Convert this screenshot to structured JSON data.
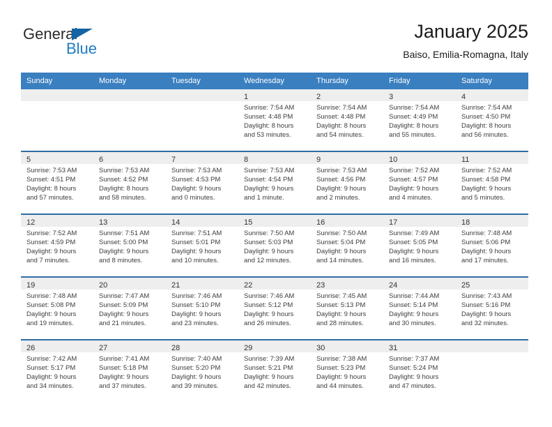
{
  "brand": {
    "name_part1": "General",
    "name_part2": "Blue",
    "triangle_color": "#1464a5",
    "blue_color": "#1d7cc4"
  },
  "header": {
    "title": "January 2025",
    "subtitle": "Baiso, Emilia-Romagna, Italy"
  },
  "theme": {
    "header_row_bg": "#3a7fc0",
    "row_divider": "#2e6da4",
    "day_band_bg": "#eeeeee"
  },
  "weekday_headers": [
    "Sunday",
    "Monday",
    "Tuesday",
    "Wednesday",
    "Thursday",
    "Friday",
    "Saturday"
  ],
  "weeks": [
    [
      {
        "day": "",
        "sunrise": "",
        "sunset": "",
        "daylight_l1": "",
        "daylight_l2": ""
      },
      {
        "day": "",
        "sunrise": "",
        "sunset": "",
        "daylight_l1": "",
        "daylight_l2": ""
      },
      {
        "day": "",
        "sunrise": "",
        "sunset": "",
        "daylight_l1": "",
        "daylight_l2": ""
      },
      {
        "day": "1",
        "sunrise": "Sunrise: 7:54 AM",
        "sunset": "Sunset: 4:48 PM",
        "daylight_l1": "Daylight: 8 hours",
        "daylight_l2": "and 53 minutes."
      },
      {
        "day": "2",
        "sunrise": "Sunrise: 7:54 AM",
        "sunset": "Sunset: 4:48 PM",
        "daylight_l1": "Daylight: 8 hours",
        "daylight_l2": "and 54 minutes."
      },
      {
        "day": "3",
        "sunrise": "Sunrise: 7:54 AM",
        "sunset": "Sunset: 4:49 PM",
        "daylight_l1": "Daylight: 8 hours",
        "daylight_l2": "and 55 minutes."
      },
      {
        "day": "4",
        "sunrise": "Sunrise: 7:54 AM",
        "sunset": "Sunset: 4:50 PM",
        "daylight_l1": "Daylight: 8 hours",
        "daylight_l2": "and 56 minutes."
      }
    ],
    [
      {
        "day": "5",
        "sunrise": "Sunrise: 7:53 AM",
        "sunset": "Sunset: 4:51 PM",
        "daylight_l1": "Daylight: 8 hours",
        "daylight_l2": "and 57 minutes."
      },
      {
        "day": "6",
        "sunrise": "Sunrise: 7:53 AM",
        "sunset": "Sunset: 4:52 PM",
        "daylight_l1": "Daylight: 8 hours",
        "daylight_l2": "and 58 minutes."
      },
      {
        "day": "7",
        "sunrise": "Sunrise: 7:53 AM",
        "sunset": "Sunset: 4:53 PM",
        "daylight_l1": "Daylight: 9 hours",
        "daylight_l2": "and 0 minutes."
      },
      {
        "day": "8",
        "sunrise": "Sunrise: 7:53 AM",
        "sunset": "Sunset: 4:54 PM",
        "daylight_l1": "Daylight: 9 hours",
        "daylight_l2": "and 1 minute."
      },
      {
        "day": "9",
        "sunrise": "Sunrise: 7:53 AM",
        "sunset": "Sunset: 4:56 PM",
        "daylight_l1": "Daylight: 9 hours",
        "daylight_l2": "and 2 minutes."
      },
      {
        "day": "10",
        "sunrise": "Sunrise: 7:52 AM",
        "sunset": "Sunset: 4:57 PM",
        "daylight_l1": "Daylight: 9 hours",
        "daylight_l2": "and 4 minutes."
      },
      {
        "day": "11",
        "sunrise": "Sunrise: 7:52 AM",
        "sunset": "Sunset: 4:58 PM",
        "daylight_l1": "Daylight: 9 hours",
        "daylight_l2": "and 5 minutes."
      }
    ],
    [
      {
        "day": "12",
        "sunrise": "Sunrise: 7:52 AM",
        "sunset": "Sunset: 4:59 PM",
        "daylight_l1": "Daylight: 9 hours",
        "daylight_l2": "and 7 minutes."
      },
      {
        "day": "13",
        "sunrise": "Sunrise: 7:51 AM",
        "sunset": "Sunset: 5:00 PM",
        "daylight_l1": "Daylight: 9 hours",
        "daylight_l2": "and 8 minutes."
      },
      {
        "day": "14",
        "sunrise": "Sunrise: 7:51 AM",
        "sunset": "Sunset: 5:01 PM",
        "daylight_l1": "Daylight: 9 hours",
        "daylight_l2": "and 10 minutes."
      },
      {
        "day": "15",
        "sunrise": "Sunrise: 7:50 AM",
        "sunset": "Sunset: 5:03 PM",
        "daylight_l1": "Daylight: 9 hours",
        "daylight_l2": "and 12 minutes."
      },
      {
        "day": "16",
        "sunrise": "Sunrise: 7:50 AM",
        "sunset": "Sunset: 5:04 PM",
        "daylight_l1": "Daylight: 9 hours",
        "daylight_l2": "and 14 minutes."
      },
      {
        "day": "17",
        "sunrise": "Sunrise: 7:49 AM",
        "sunset": "Sunset: 5:05 PM",
        "daylight_l1": "Daylight: 9 hours",
        "daylight_l2": "and 16 minutes."
      },
      {
        "day": "18",
        "sunrise": "Sunrise: 7:48 AM",
        "sunset": "Sunset: 5:06 PM",
        "daylight_l1": "Daylight: 9 hours",
        "daylight_l2": "and 17 minutes."
      }
    ],
    [
      {
        "day": "19",
        "sunrise": "Sunrise: 7:48 AM",
        "sunset": "Sunset: 5:08 PM",
        "daylight_l1": "Daylight: 9 hours",
        "daylight_l2": "and 19 minutes."
      },
      {
        "day": "20",
        "sunrise": "Sunrise: 7:47 AM",
        "sunset": "Sunset: 5:09 PM",
        "daylight_l1": "Daylight: 9 hours",
        "daylight_l2": "and 21 minutes."
      },
      {
        "day": "21",
        "sunrise": "Sunrise: 7:46 AM",
        "sunset": "Sunset: 5:10 PM",
        "daylight_l1": "Daylight: 9 hours",
        "daylight_l2": "and 23 minutes."
      },
      {
        "day": "22",
        "sunrise": "Sunrise: 7:46 AM",
        "sunset": "Sunset: 5:12 PM",
        "daylight_l1": "Daylight: 9 hours",
        "daylight_l2": "and 26 minutes."
      },
      {
        "day": "23",
        "sunrise": "Sunrise: 7:45 AM",
        "sunset": "Sunset: 5:13 PM",
        "daylight_l1": "Daylight: 9 hours",
        "daylight_l2": "and 28 minutes."
      },
      {
        "day": "24",
        "sunrise": "Sunrise: 7:44 AM",
        "sunset": "Sunset: 5:14 PM",
        "daylight_l1": "Daylight: 9 hours",
        "daylight_l2": "and 30 minutes."
      },
      {
        "day": "25",
        "sunrise": "Sunrise: 7:43 AM",
        "sunset": "Sunset: 5:16 PM",
        "daylight_l1": "Daylight: 9 hours",
        "daylight_l2": "and 32 minutes."
      }
    ],
    [
      {
        "day": "26",
        "sunrise": "Sunrise: 7:42 AM",
        "sunset": "Sunset: 5:17 PM",
        "daylight_l1": "Daylight: 9 hours",
        "daylight_l2": "and 34 minutes."
      },
      {
        "day": "27",
        "sunrise": "Sunrise: 7:41 AM",
        "sunset": "Sunset: 5:18 PM",
        "daylight_l1": "Daylight: 9 hours",
        "daylight_l2": "and 37 minutes."
      },
      {
        "day": "28",
        "sunrise": "Sunrise: 7:40 AM",
        "sunset": "Sunset: 5:20 PM",
        "daylight_l1": "Daylight: 9 hours",
        "daylight_l2": "and 39 minutes."
      },
      {
        "day": "29",
        "sunrise": "Sunrise: 7:39 AM",
        "sunset": "Sunset: 5:21 PM",
        "daylight_l1": "Daylight: 9 hours",
        "daylight_l2": "and 42 minutes."
      },
      {
        "day": "30",
        "sunrise": "Sunrise: 7:38 AM",
        "sunset": "Sunset: 5:23 PM",
        "daylight_l1": "Daylight: 9 hours",
        "daylight_l2": "and 44 minutes."
      },
      {
        "day": "31",
        "sunrise": "Sunrise: 7:37 AM",
        "sunset": "Sunset: 5:24 PM",
        "daylight_l1": "Daylight: 9 hours",
        "daylight_l2": "and 47 minutes."
      },
      {
        "day": "",
        "sunrise": "",
        "sunset": "",
        "daylight_l1": "",
        "daylight_l2": ""
      }
    ]
  ]
}
